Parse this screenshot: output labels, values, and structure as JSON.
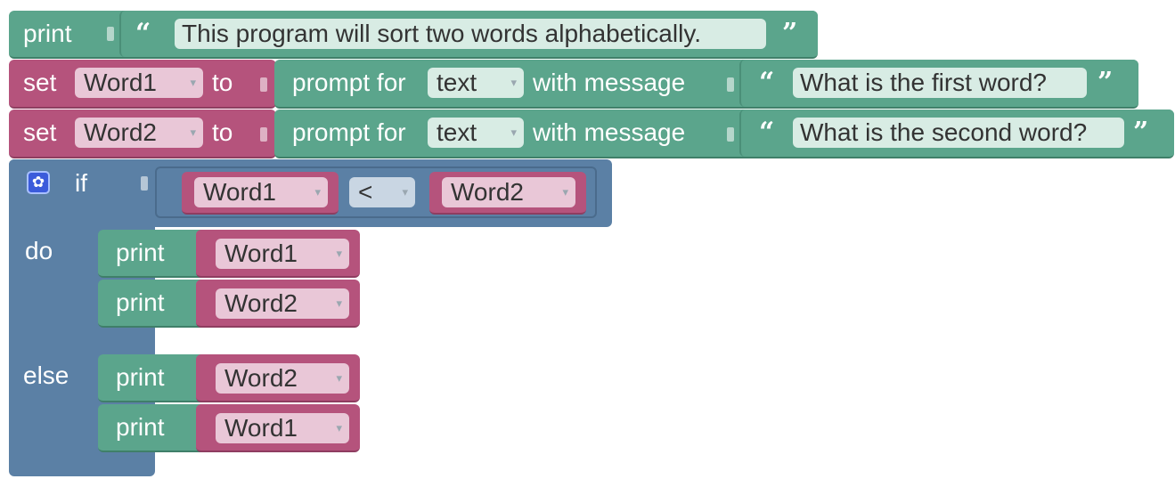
{
  "colors": {
    "text_block": "#5ba58c",
    "variable_block": "#b5537c",
    "logic_block": "#5b80a5"
  },
  "line1": {
    "keyword": "print",
    "text": "This program will sort two words alphabetically."
  },
  "line2": {
    "keyword_set": "set",
    "variable": "Word1",
    "keyword_to": "to",
    "prompt_label": "prompt for",
    "prompt_type": "text",
    "message_label": "with message",
    "message": "What is the first word?"
  },
  "line3": {
    "keyword_set": "set",
    "variable": "Word2",
    "keyword_to": "to",
    "prompt_label": "prompt for",
    "prompt_type": "text",
    "message_label": "with message",
    "message": "What is the second word?"
  },
  "if_block": {
    "if_label": "if",
    "gear_icon": "gear-icon",
    "left": "Word1",
    "operator": "<",
    "right": "Word2",
    "do_label": "do",
    "else_label": "else",
    "do_statements": [
      {
        "keyword": "print",
        "variable": "Word1"
      },
      {
        "keyword": "print",
        "variable": "Word2"
      }
    ],
    "else_statements": [
      {
        "keyword": "print",
        "variable": "Word2"
      },
      {
        "keyword": "print",
        "variable": "Word1"
      }
    ]
  },
  "icons": {
    "open_quote": "“",
    "close_quote": "”",
    "dropdown": "▾"
  }
}
